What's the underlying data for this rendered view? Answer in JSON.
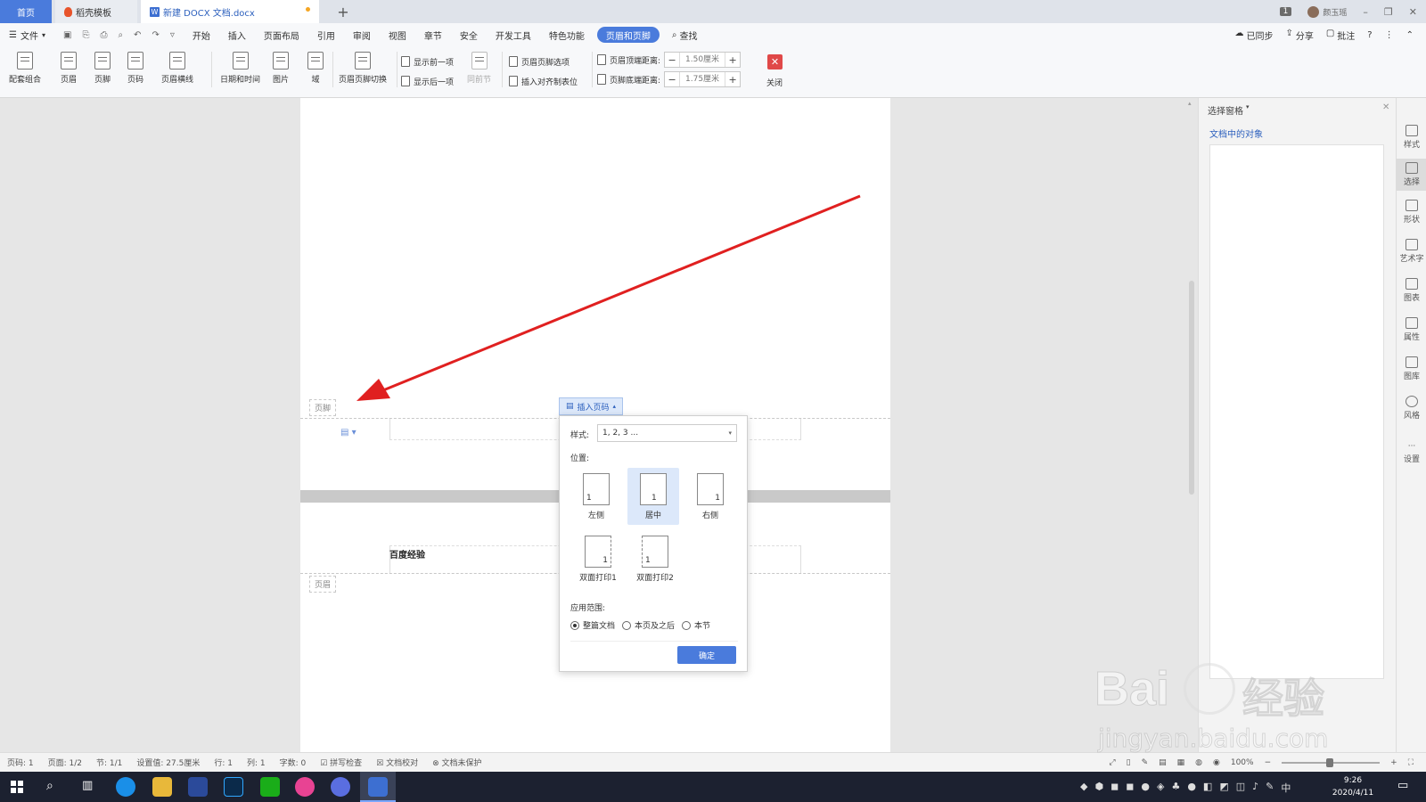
{
  "titlebar": {
    "tab_home": "首页",
    "tab_template": "稻壳模板",
    "tab_doc": "新建 DOCX 文档.docx",
    "tab_add": "+",
    "badge": "1",
    "user": "颜玉瑶"
  },
  "menu": {
    "file": "文件",
    "items": [
      "开始",
      "插入",
      "页面布局",
      "引用",
      "审阅",
      "视图",
      "章节",
      "安全",
      "开发工具",
      "特色功能"
    ],
    "active": "页眉和页脚",
    "search": "查找",
    "right": [
      "已同步",
      "分享",
      "批注"
    ]
  },
  "ribbon": {
    "btns": [
      "配套组合",
      "页眉",
      "页脚",
      "页码",
      "页眉横线",
      "日期和时间",
      "图片",
      "域",
      "页眉页脚切换"
    ],
    "show_prev": "显示前一项",
    "show_next": "显示后一项",
    "same_prev": "同前节",
    "hf_options": "页眉页脚选项",
    "insert_tab": "插入对齐制表位",
    "header_top_label": "页眉顶端距离:",
    "header_top_val": "1.50厘米",
    "footer_bottom_label": "页脚底端距离:",
    "footer_bottom_val": "1.75厘米",
    "close": "关闭",
    "minus": "−",
    "plus": "+"
  },
  "doc": {
    "footer_tag": "页脚",
    "header_tag": "页眉",
    "header_text": "百度经验",
    "insert_pagenum": "插入页码"
  },
  "popup": {
    "style_label": "样式:",
    "style_value": "1, 2, 3 ...",
    "position_label": "位置:",
    "positions": [
      "左侧",
      "居中",
      "右侧",
      "双面打印1",
      "双面打印2"
    ],
    "page_digit": "1",
    "range_label": "应用范围:",
    "ranges": [
      "整篇文档",
      "本页及之后",
      "本节"
    ],
    "ok": "确定"
  },
  "rpanel": {
    "title": "选择窗格",
    "subtitle": "文档中的对象",
    "tools": [
      "样式",
      "选择",
      "形状",
      "艺术字",
      "图表",
      "属性",
      "图库",
      "风格",
      "设置"
    ]
  },
  "status": {
    "items": [
      "页码: 1",
      "页面: 1/2",
      "节: 1/1",
      "设置值: 27.5厘米",
      "行: 1",
      "列: 1",
      "字数: 0",
      "拼写检查",
      "文档校对",
      "文档未保护"
    ],
    "zoom": "100%"
  },
  "taskbar": {
    "time": "9:26",
    "date": "2020/4/11",
    "ime": "中"
  },
  "watermark": {
    "text": "Bai",
    "text2": "经验",
    "url": "jingyan.baidu.com"
  },
  "colors": {
    "accent": "#4a7bdc",
    "arrow": "#e02020",
    "close": "#e04848"
  }
}
